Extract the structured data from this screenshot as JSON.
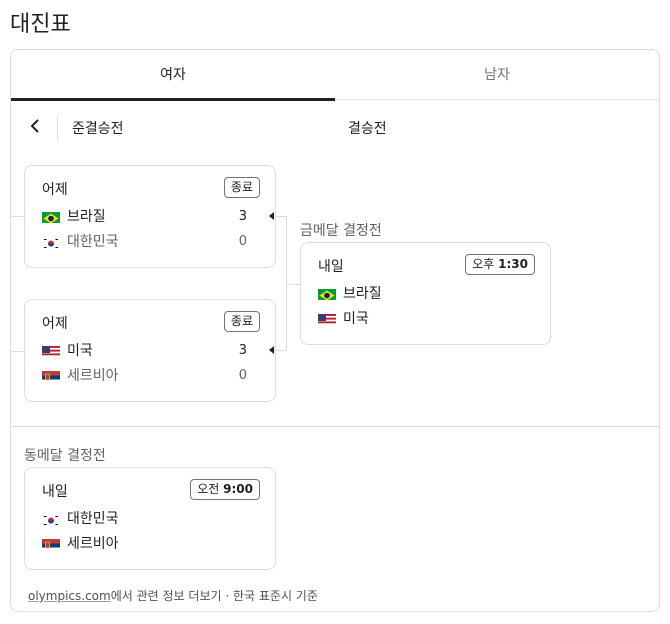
{
  "page": {
    "title": "대진표"
  },
  "tabs": [
    {
      "label": "여자",
      "selected": true
    },
    {
      "label": "남자",
      "selected": false
    }
  ],
  "rounds": {
    "semifinal": "준결승전",
    "final": "결승전"
  },
  "semifinals": [
    {
      "when": "어제",
      "status": "종료",
      "teams": [
        {
          "name": "브라질",
          "score": "3",
          "flag": "brazil",
          "winner": true
        },
        {
          "name": "대한민국",
          "score": "0",
          "flag": "south-korea",
          "winner": false
        }
      ]
    },
    {
      "when": "어제",
      "status": "종료",
      "teams": [
        {
          "name": "미국",
          "score": "3",
          "flag": "usa",
          "winner": true
        },
        {
          "name": "세르비아",
          "score": "0",
          "flag": "serbia",
          "winner": false
        }
      ]
    }
  ],
  "gold_match": {
    "label": "금메달 결정전",
    "when": "내일",
    "time_prefix": "오후",
    "time": "1:30",
    "teams": [
      {
        "name": "브라질",
        "flag": "brazil"
      },
      {
        "name": "미국",
        "flag": "usa"
      }
    ]
  },
  "bronze_match": {
    "label": "동메달 결정전",
    "when": "내일",
    "time_prefix": "오전",
    "time": "9:00",
    "teams": [
      {
        "name": "대한민국",
        "flag": "south-korea"
      },
      {
        "name": "세르비아",
        "flag": "serbia"
      }
    ]
  },
  "footer": {
    "link": "olympics.com",
    "text": "에서 관련 정보 더보기 · 한국 표준시 기준"
  },
  "colors": {
    "border": "#dadce0",
    "text": "#202124",
    "muted": "#5f6368"
  }
}
